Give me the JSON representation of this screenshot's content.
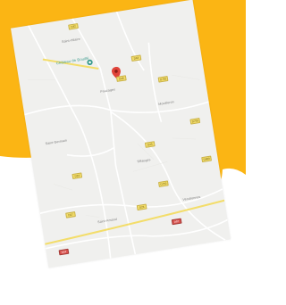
{
  "colors": {
    "accent": "#fbb514",
    "map_bg": "#f0f0ee",
    "road": "#ffffff",
    "highway": "#f3dd6a",
    "pin": "#e0443a",
    "poi": "#3a9b8d"
  },
  "map": {
    "pin_icon": "map-pin-icon",
    "poi_icon": "place-marker-icon",
    "labels": {
      "top": "Saint-Hilaire",
      "poi": "Château de Bouillé",
      "center": "Pouzages",
      "east": "Mouilleron",
      "west": "Saint-Germain",
      "mid": "Tiffauges",
      "south": "Saint-Amand",
      "southeast": "Vendrennes"
    },
    "shields": [
      "D32",
      "D43",
      "D49",
      "D752",
      "D755",
      "D23",
      "D24",
      "D960",
      "D752",
      "D27",
      "D23",
      "A87",
      "D24"
    ]
  }
}
